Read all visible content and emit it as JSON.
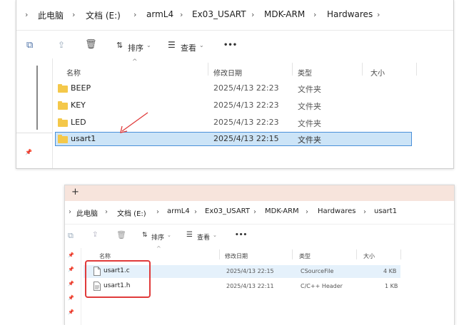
{
  "win1": {
    "breadcrumb": [
      "此电脑",
      "文档 (E:)",
      "armL4",
      "Ex03_USART",
      "MDK-ARM",
      "Hardwares"
    ],
    "toolbar": {
      "sort_label": "排序",
      "view_label": "查看",
      "more_label": "•••"
    },
    "columns": [
      "名称",
      "修改日期",
      "类型",
      "大小"
    ],
    "rows": [
      {
        "name": "BEEP",
        "date": "2025/4/13 22:23",
        "type": "文件夹"
      },
      {
        "name": "KEY",
        "date": "2025/4/13 22:23",
        "type": "文件夹"
      },
      {
        "name": "LED",
        "date": "2025/4/13 22:23",
        "type": "文件夹"
      },
      {
        "name": "usart1",
        "date": "2025/4/13 22:15",
        "type": "文件夹"
      }
    ]
  },
  "win2": {
    "tab_plus": "+",
    "breadcrumb": [
      "此电脑",
      "文档 (E:)",
      "armL4",
      "Ex03_USART",
      "MDK-ARM",
      "Hardwares",
      "usart1"
    ],
    "toolbar": {
      "sort_label": "排序",
      "view_label": "查看",
      "more_label": "•••"
    },
    "columns": [
      "名称",
      "修改日期",
      "类型",
      "大小"
    ],
    "rows": [
      {
        "name": "usart1.c",
        "date": "2025/4/13 22:15",
        "type": "CSourceFile",
        "size": "4 KB"
      },
      {
        "name": "usart1.h",
        "date": "2025/4/13 22:11",
        "type": "C/C++ Header",
        "size": "1 KB"
      }
    ]
  },
  "colors": {
    "selected_bg": "#cce4f7",
    "selected_border": "#4a90d9",
    "hover_bg": "#e5f1fb",
    "annotation_red": "#e03a3a",
    "tab_bar": "#f7e4dc"
  }
}
